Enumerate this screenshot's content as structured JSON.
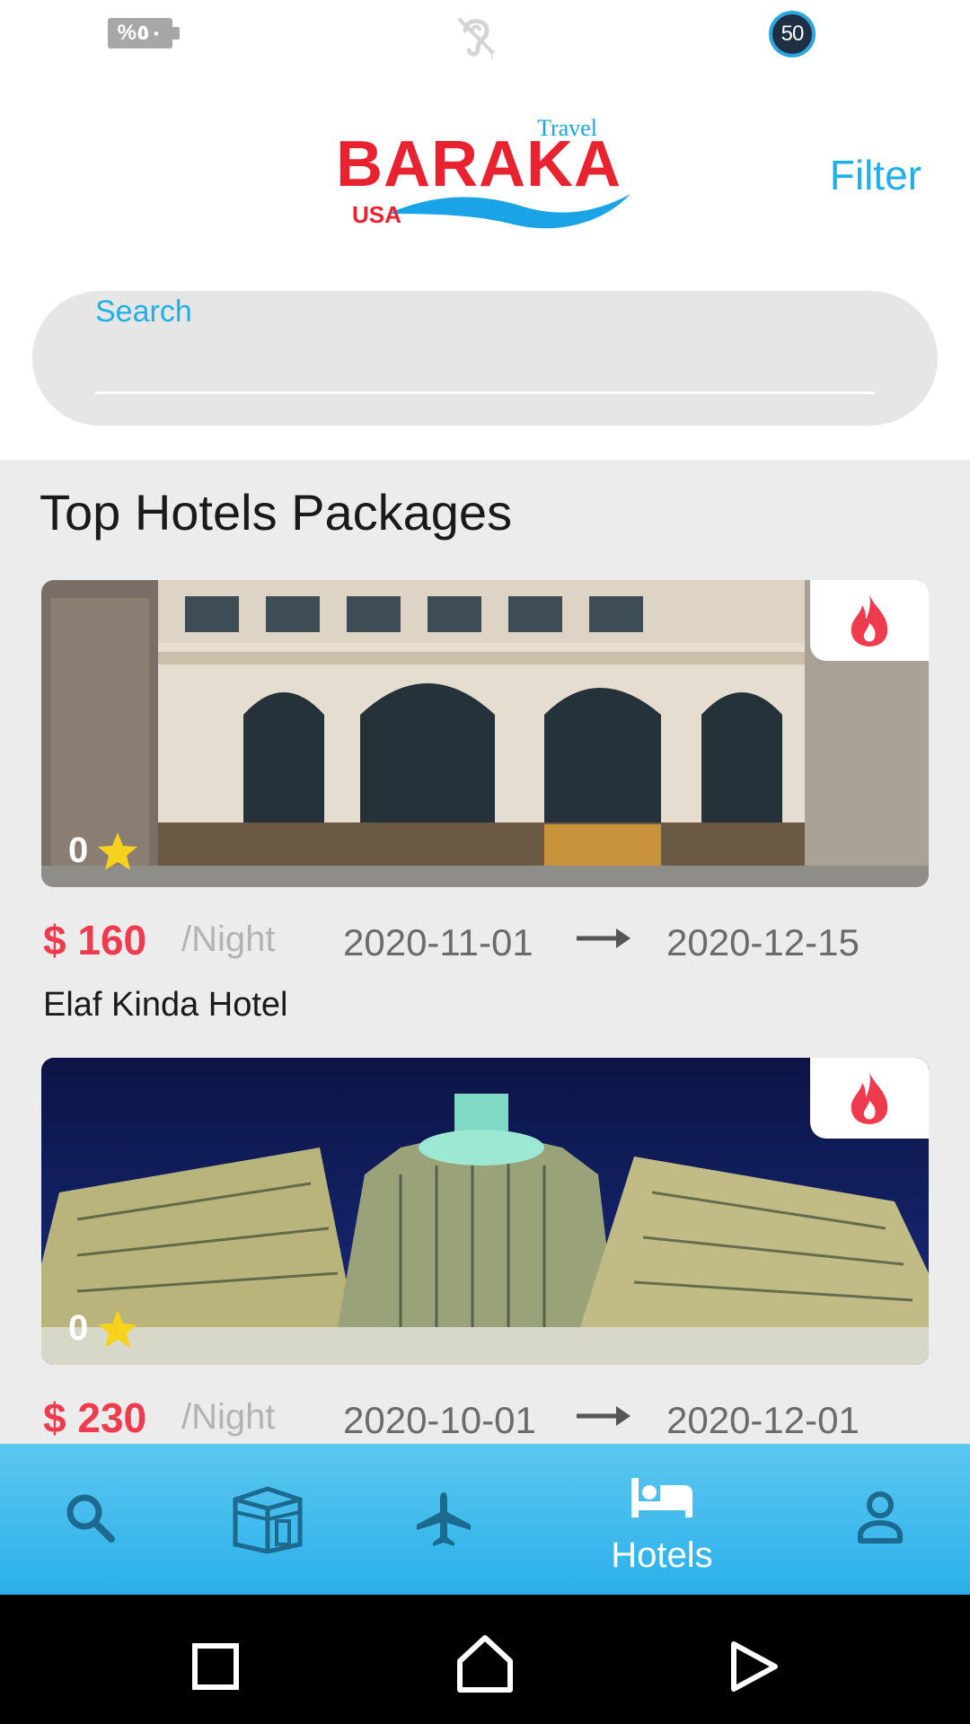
{
  "status_bar": {
    "battery_text": "%٥٠",
    "speed_badge": "50",
    "icons": [
      "battery-icon",
      "hearing-aid-icon",
      "speed-badge-icon"
    ]
  },
  "header": {
    "logo": {
      "travel": "Travel",
      "main": "BARAKA",
      "usa": "USA"
    },
    "filter_label": "Filter"
  },
  "search": {
    "label": "Search",
    "value": "",
    "placeholder": ""
  },
  "section": {
    "title": "Top Hotels Packages"
  },
  "hotels": [
    {
      "name": "Elaf Kinda Hotel",
      "price": "$ 160",
      "per_night": "/Night",
      "date_from": "2020-11-01",
      "date_to": "2020-12-15",
      "rating": "0",
      "badge_icon": "fire-icon"
    },
    {
      "name": "",
      "price": "$ 230",
      "per_night": "/Night",
      "date_from": "2020-10-01",
      "date_to": "2020-12-01",
      "rating": "0",
      "badge_icon": "fire-icon"
    }
  ],
  "bottom_nav": {
    "items": [
      {
        "icon": "search-icon",
        "label": ""
      },
      {
        "icon": "kaaba-icon",
        "label": ""
      },
      {
        "icon": "airplane-icon",
        "label": ""
      },
      {
        "icon": "bed-icon",
        "label": "Hotels",
        "active": true
      },
      {
        "icon": "person-icon",
        "label": ""
      }
    ]
  },
  "colors": {
    "accent": "#1fb0ea",
    "price": "#ee3b4e",
    "nav_bg": "#2bb0ea",
    "nav_icon": "#1d6a8f",
    "content_bg": "#ececec"
  }
}
